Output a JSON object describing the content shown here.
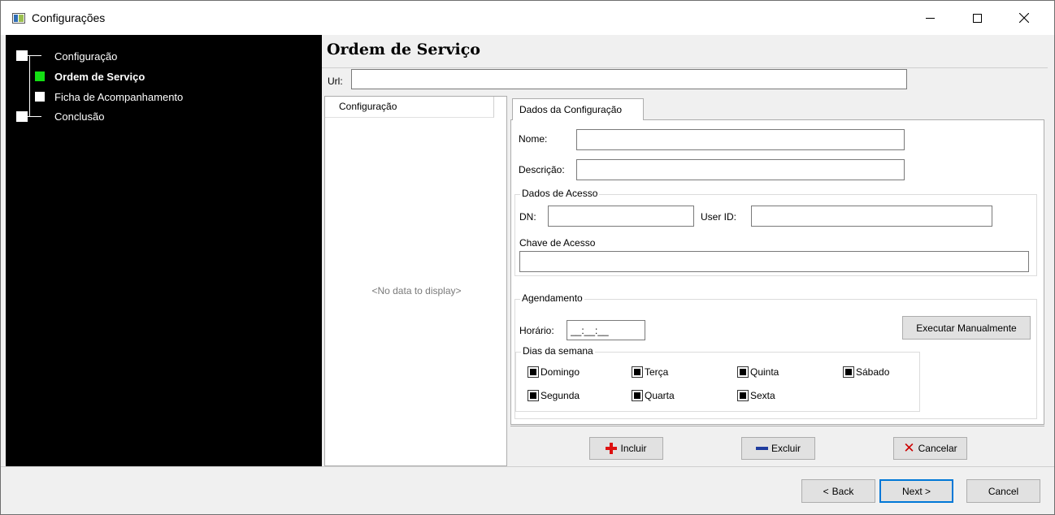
{
  "window": {
    "title": "Configurações"
  },
  "steps": [
    {
      "label": "Configuração",
      "state": "done"
    },
    {
      "label": "Ordem de Serviço",
      "state": "current"
    },
    {
      "label": "Ficha de Acompanhamento",
      "state": "pending"
    },
    {
      "label": "Conclusão",
      "state": "pending"
    }
  ],
  "page": {
    "title": "Ordem de Serviço"
  },
  "url": {
    "label": "Url:",
    "value": ""
  },
  "list": {
    "header": "Configuração",
    "empty_text": "<No data to display>"
  },
  "tab": {
    "label": "Dados da Configuração"
  },
  "form": {
    "nome_label": "Nome:",
    "nome_value": "",
    "descricao_label": "Descrição:",
    "descricao_value": "",
    "acesso": {
      "title": "Dados de Acesso",
      "dn_label": "DN:",
      "dn_value": "",
      "userid_label": "User ID:",
      "userid_value": "",
      "chave_label": "Chave de Acesso",
      "chave_value": ""
    },
    "agendamento": {
      "title": "Agendamento",
      "horario_label": "Horário:",
      "horario_value": "__:__:__",
      "run_button": "Executar Manualmente",
      "dias_title": "Dias da semana",
      "days": [
        "Domingo",
        "Terça",
        "Quinta",
        "Sábado",
        "Segunda",
        "Quarta",
        "Sexta"
      ]
    }
  },
  "actions": {
    "incluir": "Incluir",
    "excluir": "Excluir",
    "cancelar": "Cancelar"
  },
  "footer": {
    "back": "Back",
    "next": "Next >",
    "cancel": "Cancel"
  },
  "colors": {
    "current_step": "#14e014",
    "sidebar_bg": "#000000",
    "default_button_border": "#0078d7"
  }
}
